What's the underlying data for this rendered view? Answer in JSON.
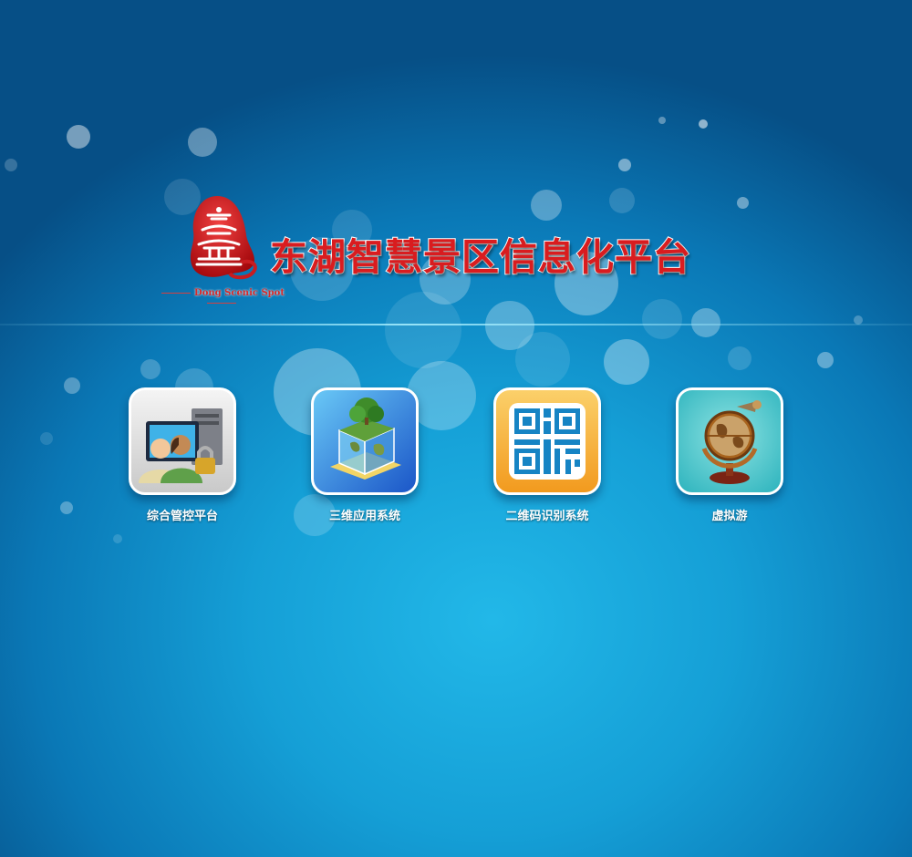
{
  "header": {
    "title": "东湖智慧景区信息化平台",
    "logo_caption": "Dong Scenic Spot",
    "logo_icon": "pagoda-seal-icon"
  },
  "apps": [
    {
      "label": "综合管控平台",
      "icon": "users-monitor-lock-icon"
    },
    {
      "label": "三维应用系统",
      "icon": "3d-globe-cube-icon"
    },
    {
      "label": "二维码识别系统",
      "icon": "qr-code-icon"
    },
    {
      "label": "虚拟游",
      "icon": "antique-globe-icon"
    }
  ],
  "colors": {
    "title_red": "#d91c1f",
    "background_blue": "#159fd6",
    "qr_tile_orange": "#f6a62a",
    "globe_tile_teal": "#37c0c4"
  }
}
